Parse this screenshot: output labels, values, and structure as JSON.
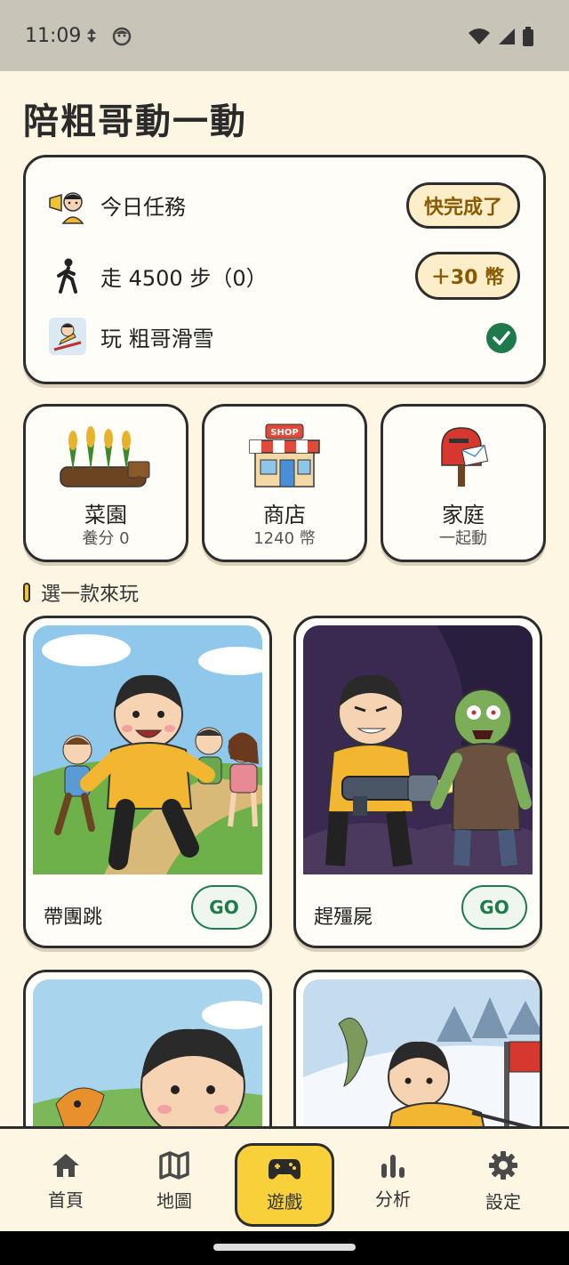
{
  "status": {
    "time": "11:09"
  },
  "app": {
    "title": "陪粗哥動一動"
  },
  "tasks": {
    "header": "今日任務",
    "header_button": "快完成了",
    "walk_label": "走 4500 步（0）",
    "walk_button": "＋30 幣",
    "ski_label": "玩 粗哥滑雪"
  },
  "tiles": [
    {
      "title": "菜園",
      "subtitle": "養分 0",
      "icon": "garden-icon"
    },
    {
      "title": "商店",
      "subtitle": "1240 幣",
      "icon": "shop-icon"
    },
    {
      "title": "家庭",
      "subtitle": "一起動",
      "icon": "mailbox-icon"
    }
  ],
  "shop_sign": "SHOP",
  "section": {
    "title": "選一款來玩"
  },
  "games": [
    {
      "name": "帶團跳",
      "button": "GO"
    },
    {
      "name": "趕殭屍",
      "button": "GO"
    }
  ],
  "nav": [
    {
      "label": "首頁",
      "icon": "home-icon"
    },
    {
      "label": "地圖",
      "icon": "map-icon"
    },
    {
      "label": "遊戲",
      "icon": "gamepad-icon",
      "active": true
    },
    {
      "label": "分析",
      "icon": "bar-chart-icon"
    },
    {
      "label": "設定",
      "icon": "gear-icon"
    }
  ],
  "colors": {
    "background": "#fdf6e3",
    "accent_yellow": "#f8d13a",
    "go_green": "#1e7a4b",
    "pill_bg": "#fbeec8"
  }
}
